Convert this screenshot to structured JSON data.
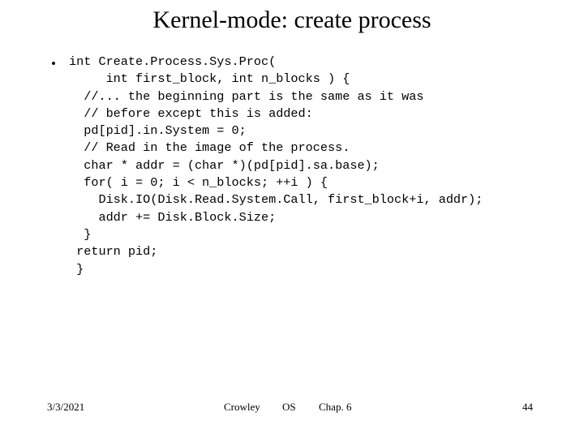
{
  "slide": {
    "title": "Kernel-mode: create process",
    "bullet_mark": "•",
    "code": "int Create.Process.Sys.Proc(\n     int first_block, int n_blocks ) {\n  //... the beginning part is the same as it was\n  // before except this is added:\n  pd[pid].in.System = 0;\n  // Read in the image of the process.\n  char * addr = (char *)(pd[pid].sa.base);\n  for( i = 0; i < n_blocks; ++i ) {\n    Disk.IO(Disk.Read.System.Call, first_block+i, addr);\n    addr += Disk.Block.Size;\n  }\n return pid;\n }"
  },
  "footer": {
    "date": "3/3/2021",
    "author": "Crowley",
    "course": "OS",
    "chapter": "Chap. 6",
    "page": "44"
  }
}
